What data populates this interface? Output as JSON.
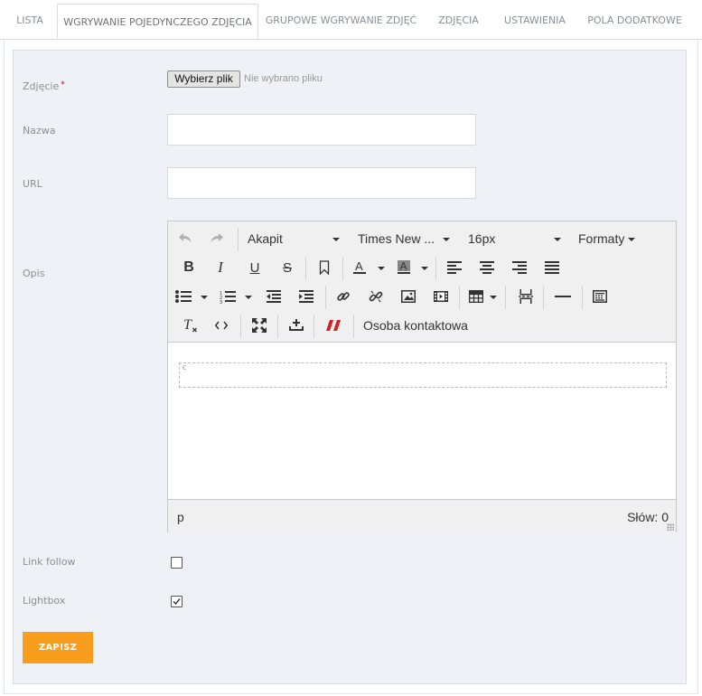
{
  "tabs": [
    {
      "label": "LISTA"
    },
    {
      "label": "WGRYWANIE POJEDYNCZEGO ZDJĘCIA"
    },
    {
      "label": "GRUPOWE WGRYWANIE ZDJĘĆ"
    },
    {
      "label": "ZDJĘCIA"
    },
    {
      "label": "USTAWIENIA"
    },
    {
      "label": "POLA DODATKOWE"
    }
  ],
  "active_tab": "WGRYWANIE POJEDYNCZEGO ZDJĘCIA",
  "form": {
    "photo_label": "Zdjęcie",
    "required_mark": "*",
    "file_button": "Wybierz plik",
    "file_status": "Nie wybrano pliku",
    "name_label": "Nazwa",
    "name_value": "",
    "url_label": "URL",
    "url_value": "",
    "desc_label": "Opis",
    "link_follow_label": "Link follow",
    "link_follow_checked": false,
    "lightbox_label": "Lightbox",
    "lightbox_checked": true,
    "save_label": "ZAPISZ"
  },
  "editor": {
    "paragraph_select": "Akapit",
    "font_select": "Times New ...",
    "size_select": "16px",
    "formats_menu": "Formaty",
    "contact_button": "Osoba kontaktowa",
    "status_path": "p",
    "word_count": "Słów: 0",
    "anchor_glyph": "Ꞓ"
  },
  "colors": {
    "accent": "#f99d1c",
    "panel_bg": "#eef1f5",
    "required": "#d0021b",
    "icon_red": "#d21f1f"
  }
}
